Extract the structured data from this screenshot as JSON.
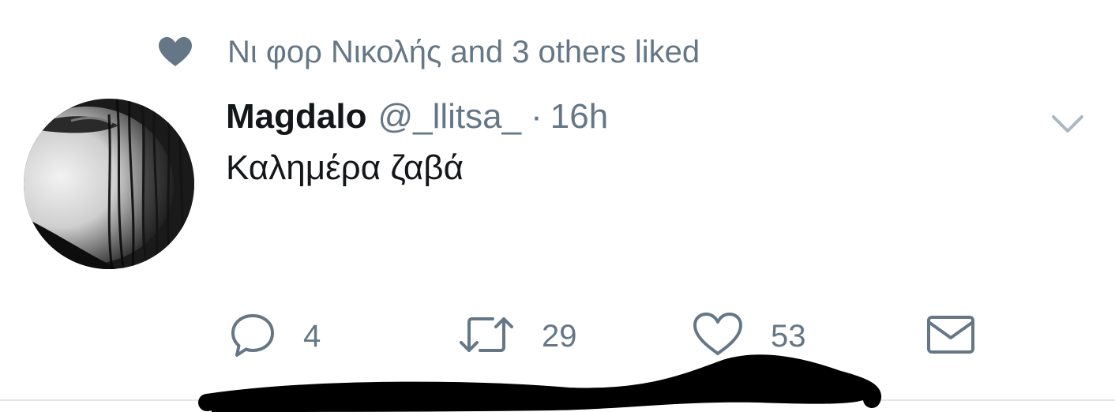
{
  "social_context": {
    "icon": "heart-icon",
    "text": "Νι φορ Νικολής and 3 others liked"
  },
  "tweet": {
    "avatar_icon": "avatar",
    "display_name": "Magdalo",
    "handle": "@_llitsa_",
    "separator": "·",
    "time": "16h",
    "text": "Καλημέρα ζαβά"
  },
  "actions": {
    "reply": {
      "icon": "reply-icon",
      "count": "4"
    },
    "retweet": {
      "icon": "retweet-icon",
      "count": "29"
    },
    "like": {
      "icon": "heart-outline-icon",
      "count": "53"
    },
    "dm": {
      "icon": "envelope-icon"
    }
  },
  "colors": {
    "secondary_text": "#657786",
    "primary_text": "#14171a",
    "icon_gray": "#657786",
    "divider": "#e1e8ed"
  }
}
